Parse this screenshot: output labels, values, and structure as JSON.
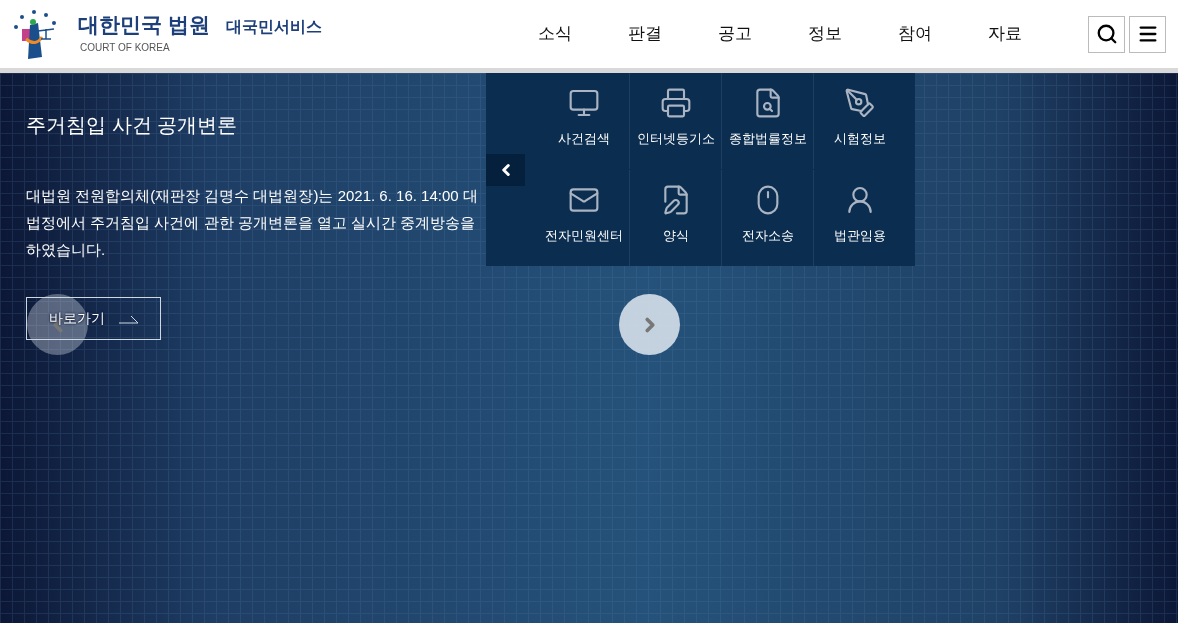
{
  "header": {
    "logo_title": "대한민국 법원",
    "logo_subtitle": "COURT OF KOREA",
    "service_name": "대국민서비스",
    "nav": [
      {
        "label": "소식"
      },
      {
        "label": "판결"
      },
      {
        "label": "공고"
      },
      {
        "label": "정보"
      },
      {
        "label": "참여"
      },
      {
        "label": "자료"
      }
    ]
  },
  "banner": {
    "title": "주거침입 사건 공개변론",
    "body": "대법원 전원합의체(재판장 김명수 대법원장)는 2021. 6. 16. 14:00 대법정에서 주거침입 사건에 관한 공개변론을 열고 실시간 중계방송을 하였습니다.",
    "link_label": "바로가기"
  },
  "quick_menu": [
    {
      "label": "사건검색"
    },
    {
      "label": "인터넷등기소"
    },
    {
      "label": "종합법률정보"
    },
    {
      "label": "시험정보"
    },
    {
      "label": "전자민원센터"
    },
    {
      "label": "양식"
    },
    {
      "label": "전자소송"
    },
    {
      "label": "법관임용"
    }
  ]
}
